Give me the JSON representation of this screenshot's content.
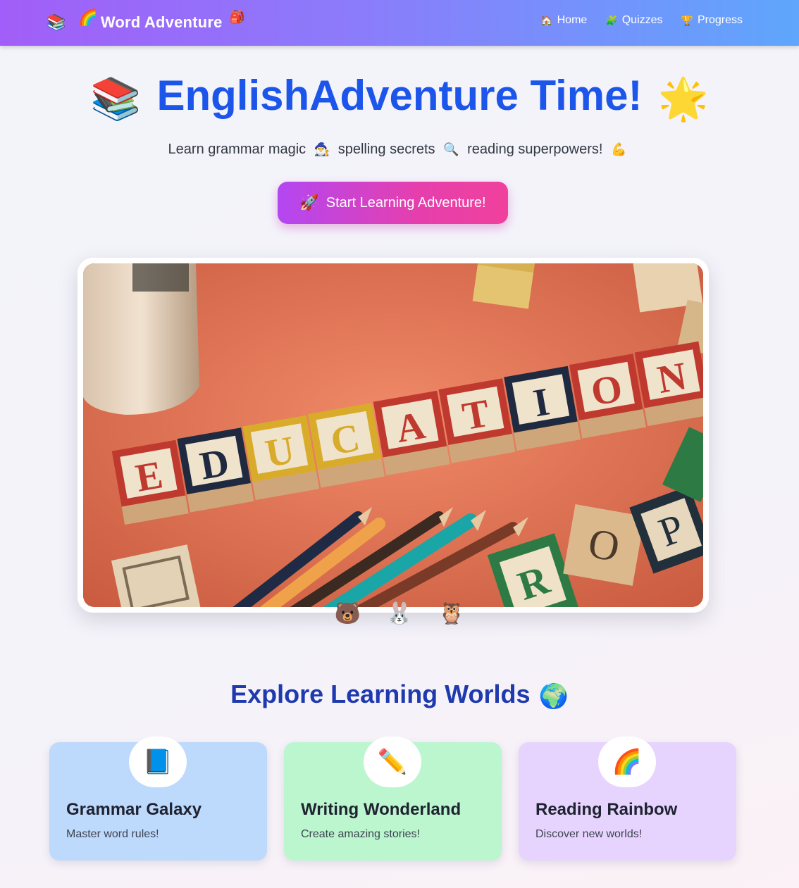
{
  "header": {
    "brand": {
      "books_emoji": "📚",
      "rainbow_emoji": "🌈",
      "title": "Word Adventure",
      "bag_emoji": "🎒"
    },
    "nav": [
      {
        "icon": "🏠",
        "label": "Home"
      },
      {
        "icon": "🧩",
        "label": "Quizzes"
      },
      {
        "icon": "🏆",
        "label": "Progress"
      }
    ]
  },
  "hero": {
    "title_emoji_left": "📚",
    "title": "EnglishAdventure Time!",
    "title_emoji_right": "🌟",
    "subtitle": {
      "part1": "Learn grammar magic",
      "emoji1": "🧙‍♂️",
      "part2": "spelling secrets",
      "emoji2": "🔍",
      "part3": "reading superpowers!",
      "emoji3": "💪"
    },
    "cta": {
      "icon": "🚀",
      "label": "Start Learning Adventure!"
    }
  },
  "photo": {
    "alt_letters": "EDUCATION"
  },
  "mascots": [
    "🐻",
    "🐰",
    "🦉"
  ],
  "explore": {
    "title": "Explore Learning Worlds",
    "emoji": "🌍",
    "cards": [
      {
        "icon": "📘",
        "title": "Grammar Galaxy",
        "desc": "Master word rules!"
      },
      {
        "icon": "✏️",
        "title": "Writing Wonderland",
        "desc": "Create amazing stories!"
      },
      {
        "icon": "🌈",
        "title": "Reading Rainbow",
        "desc": "Discover new worlds!"
      }
    ]
  },
  "colors": {
    "accent_blue": "#1c55ea",
    "explore_title": "#1e3aae",
    "card_blue": "#bdd9fc",
    "card_green": "#bbf6cf",
    "card_purple": "#e7d4fe"
  }
}
